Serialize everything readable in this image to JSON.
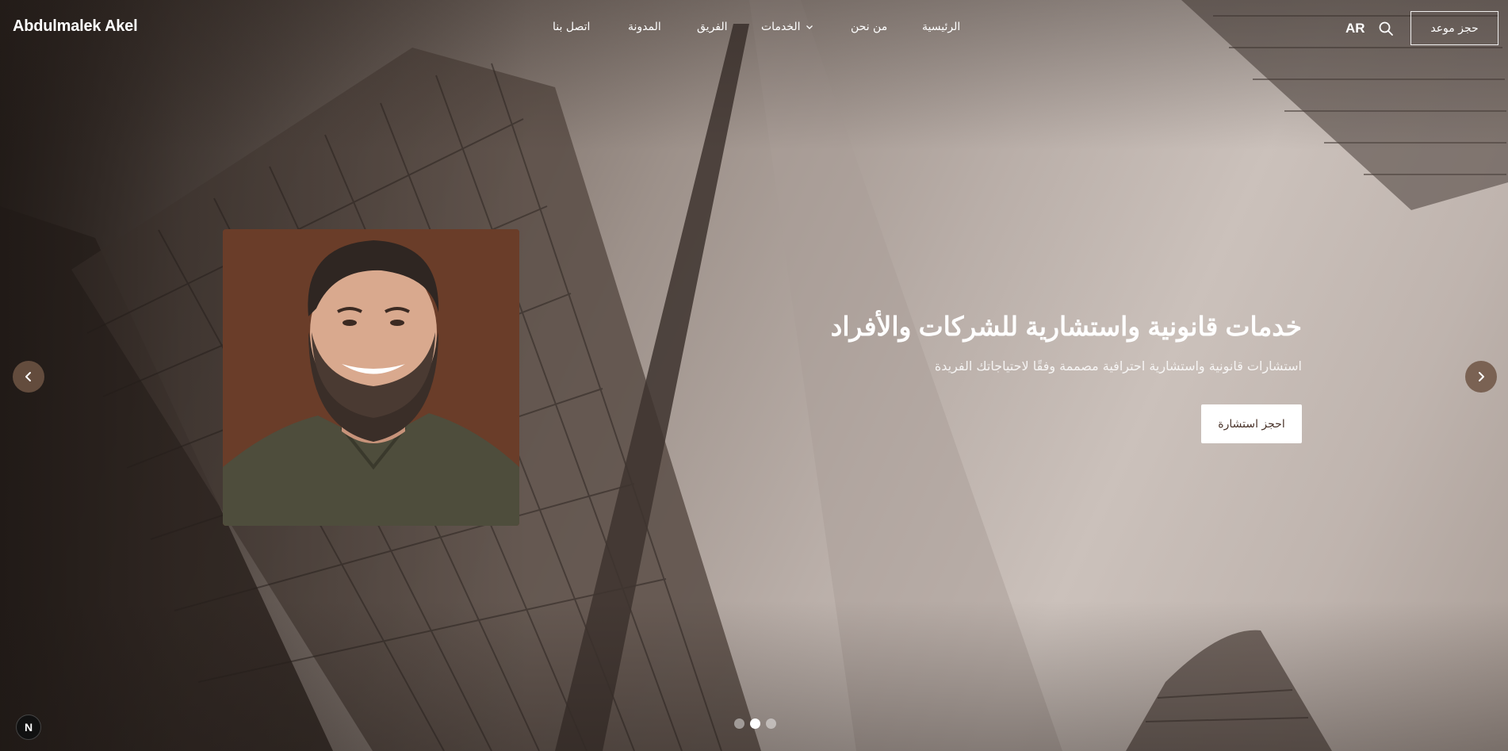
{
  "header": {
    "logo": "Abdulmalek Akel",
    "nav": [
      {
        "label": "الرئيسية"
      },
      {
        "label": "من نحن"
      },
      {
        "label": "الخدمات"
      },
      {
        "label": "الفريق"
      },
      {
        "label": "المدونة"
      },
      {
        "label": "اتصل بنا"
      }
    ],
    "lang": "AR",
    "book_label": "حجز موعد",
    "icons": {
      "search": "search-icon",
      "dropdown": "chevron-down-icon"
    }
  },
  "hero": {
    "title": "خدمات قانونية واستشارية للشركات والأفراد",
    "subtitle": "استشارات قانونية واستشارية احترافية مصممة وفقًا لاحتياجاتك الفريدة",
    "cta_label": "احجز استشارة",
    "prev_icon": "chevron-left-icon",
    "next_icon": "chevron-right-icon"
  },
  "carousel": {
    "slides": 3,
    "active_index": 1
  },
  "badge": {
    "label": "N"
  },
  "colors": {
    "accent": "#4a342b",
    "arrow_bg": "#6e5544",
    "portrait_bg": "#6a3d29"
  }
}
